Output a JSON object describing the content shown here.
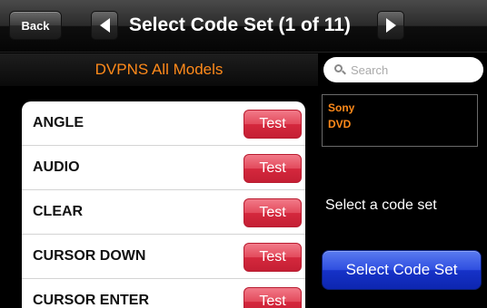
{
  "navbar": {
    "back_label": "Back",
    "title": "Select Code Set (1 of 11)"
  },
  "model": {
    "label": "DVPNS All Models"
  },
  "list": {
    "test_label": "Test",
    "items": [
      {
        "label": "ANGLE"
      },
      {
        "label": "AUDIO"
      },
      {
        "label": "CLEAR"
      },
      {
        "label": "CURSOR DOWN"
      },
      {
        "label": "CURSOR ENTER"
      }
    ]
  },
  "search": {
    "placeholder": "Search",
    "value": ""
  },
  "selection": {
    "brand": "Sony",
    "device": "DVD"
  },
  "hint": "Select a code set",
  "select_button_label": "Select Code Set",
  "colors": {
    "accent_orange": "#ff8a1a",
    "test_red": "#e34a5c",
    "select_blue": "#2f4ee0"
  }
}
